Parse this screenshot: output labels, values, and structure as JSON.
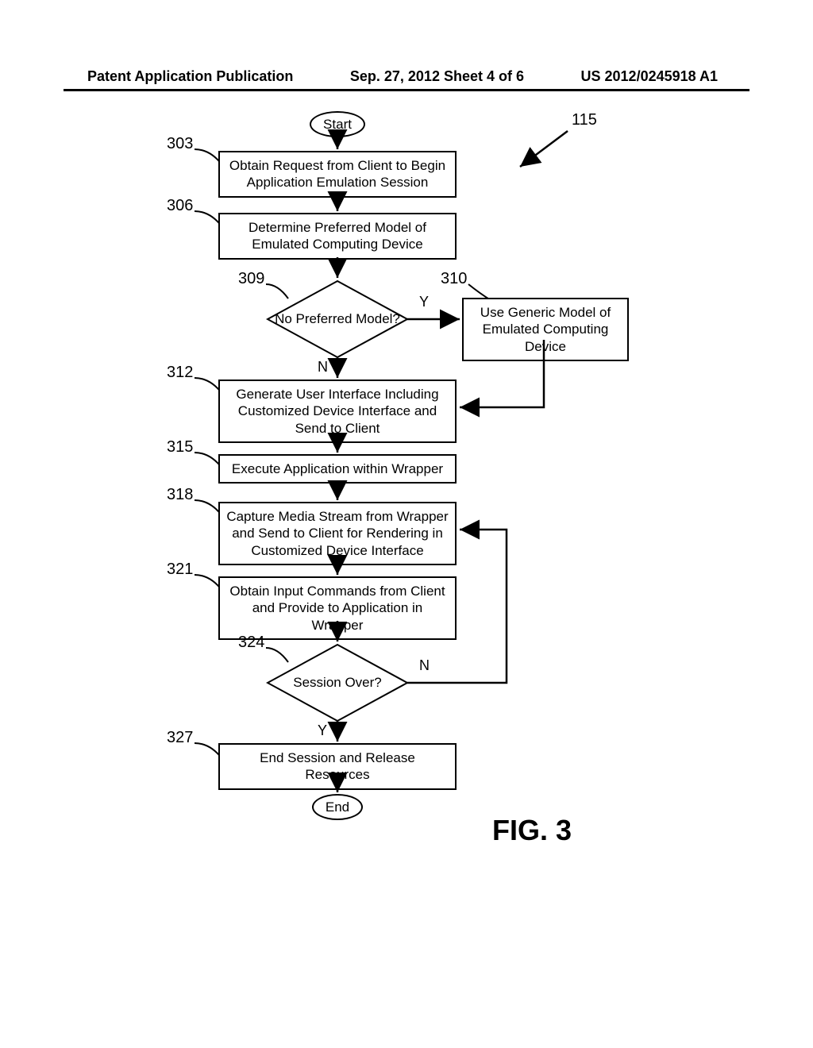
{
  "header": {
    "left": "Patent Application Publication",
    "center": "Sep. 27, 2012  Sheet 4 of 6",
    "right": "US 2012/0245918 A1"
  },
  "figure_label": "FIG. 3",
  "refs": {
    "r115": "115",
    "r303": "303",
    "r306": "306",
    "r309": "309",
    "r310": "310",
    "r312": "312",
    "r315": "315",
    "r318": "318",
    "r321": "321",
    "r324": "324",
    "r327": "327"
  },
  "nodes": {
    "start": "Start",
    "n303": "Obtain Request from Client to Begin Application Emulation Session",
    "n306": "Determine Preferred Model of Emulated Computing Device",
    "d309": "No Preferred Model?",
    "n310": "Use Generic Model of Emulated Computing Device",
    "n312": "Generate User Interface Including Customized Device Interface and Send to Client",
    "n315": "Execute Application within Wrapper",
    "n318": "Capture Media Stream from Wrapper and Send to Client for Rendering in Customized Device Interface",
    "n321": "Obtain Input Commands from Client and Provide to Application in Wrapper",
    "d324": "Session Over?",
    "n327": "End Session and Release Resources",
    "end": "End"
  },
  "edges": {
    "y": "Y",
    "n": "N"
  }
}
